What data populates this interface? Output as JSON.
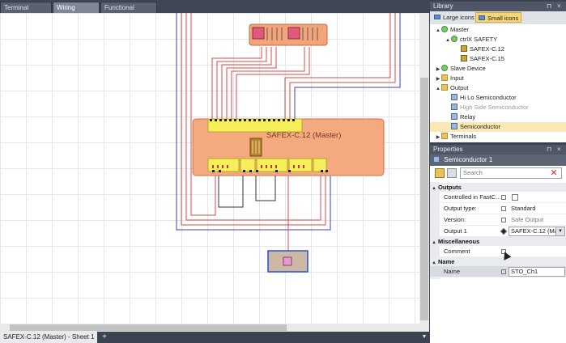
{
  "tabs": [
    {
      "label": "Terminal Scheme",
      "active": false
    },
    {
      "label": "Wiring Scheme",
      "active": true
    },
    {
      "label": "Functional Scheme",
      "active": false
    }
  ],
  "diagram": {
    "module_label": "SAFEX-C.12 (Master)"
  },
  "sheet": {
    "tab_label": "SAFEX-C.12 (Master) - Sheet 1",
    "add_label": "+"
  },
  "library": {
    "title": "Library",
    "views": [
      {
        "label": "Large icons",
        "active": false
      },
      {
        "label": "Small icons",
        "active": true
      }
    ],
    "tree": [
      {
        "label": "Master",
        "level": 0,
        "twist": "▲",
        "icon": "ic-green"
      },
      {
        "label": "ctrlX SAFETY",
        "level": 1,
        "twist": "▲",
        "icon": "ic-green"
      },
      {
        "label": "SAFEX-C.12",
        "level": 2,
        "twist": "",
        "icon": "ic-module"
      },
      {
        "label": "SAFEX-C.15",
        "level": 2,
        "twist": "",
        "icon": "ic-module"
      },
      {
        "label": "Slave Device",
        "level": 0,
        "twist": "▶",
        "icon": "ic-green"
      },
      {
        "label": "Input",
        "level": 0,
        "twist": "▶",
        "icon": "ic-folder"
      },
      {
        "label": "Output",
        "level": 0,
        "twist": "▲",
        "icon": "ic-folder"
      },
      {
        "label": "Hi Lo Semiconductor",
        "level": 1,
        "twist": "",
        "icon": "ic-output"
      },
      {
        "label": "High Side Semiconductor",
        "level": 1,
        "twist": "",
        "icon": "ic-output",
        "disabled": true
      },
      {
        "label": "Relay",
        "level": 1,
        "twist": "",
        "icon": "ic-output"
      },
      {
        "label": "Semiconductor",
        "level": 1,
        "twist": "",
        "icon": "ic-output",
        "selected": true
      },
      {
        "label": "Terminals",
        "level": 0,
        "twist": "▶",
        "icon": "ic-folder"
      }
    ]
  },
  "properties": {
    "title": "Properties",
    "object": "Semiconductor 1",
    "search_placeholder": "Search",
    "categories": {
      "outputs": "Outputs",
      "misc": "Miscellaneous",
      "name": "Name"
    },
    "rows": {
      "controlled": {
        "label": "Controlled in FastC...",
        "checked": false
      },
      "output_type": {
        "label": "Output type:",
        "value": "Standard"
      },
      "version": {
        "label": "Version:",
        "value": "Safe Output"
      },
      "output1": {
        "label": "Output 1",
        "value": "SAFEX-C.12 (Ma"
      },
      "comment": {
        "label": "Comment",
        "value": ""
      },
      "name": {
        "label": "Name",
        "value": "STO_Ch1"
      }
    }
  }
}
